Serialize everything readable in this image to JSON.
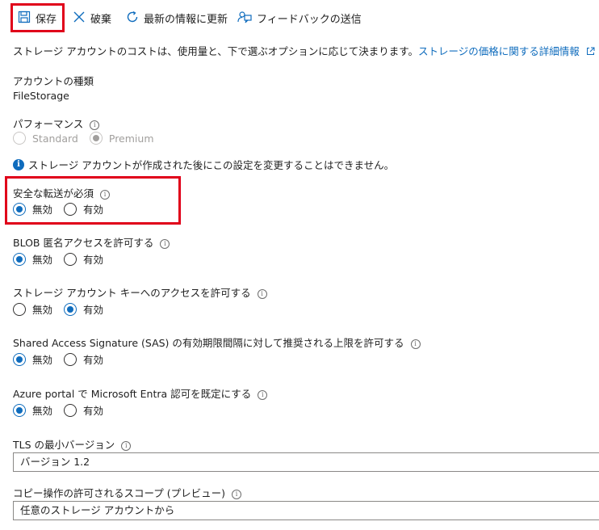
{
  "toolbar": {
    "save_label": "保存",
    "discard_label": "破棄",
    "refresh_label": "最新の情報に更新",
    "feedback_label": "フィードバックの送信"
  },
  "description": {
    "text": "ストレージ アカウントのコストは、使用量と、下で選ぶオプションに応じて決まります。",
    "link_text": "ストレージの価格に関する詳細情報"
  },
  "account_kind": {
    "label": "アカウントの種類",
    "value": "FileStorage"
  },
  "performance": {
    "label": "パフォーマンス",
    "options": [
      "Standard",
      "Premium"
    ],
    "selected": "Premium"
  },
  "notice": "ストレージ アカウントが作成された後にこの設定を変更することはできません。",
  "settings": {
    "secure_transfer": {
      "label": "安全な転送が必須",
      "options": [
        "無効",
        "有効"
      ],
      "selected": "無効"
    },
    "blob_anonymous": {
      "label": "BLOB 匿名アクセスを許可する",
      "options": [
        "無効",
        "有効"
      ],
      "selected": "無効"
    },
    "account_key": {
      "label": "ストレージ アカウント キーへのアクセスを許可する",
      "options": [
        "無効",
        "有効"
      ],
      "selected": "有効"
    },
    "sas_expiry": {
      "label": "Shared Access Signature (SAS) の有効期限間隔に対して推奨される上限を許可する",
      "options": [
        "無効",
        "有効"
      ],
      "selected": "無効"
    },
    "entra_default": {
      "label": "Azure portal で Microsoft Entra 認可を既定にする",
      "options": [
        "無効",
        "有効"
      ],
      "selected": "無効"
    }
  },
  "tls": {
    "label": "TLS の最小バージョン",
    "value": "バージョン 1.2"
  },
  "copy_scope": {
    "label": "コピー操作の許可されるスコープ (プレビュー)",
    "value": "任意のストレージ アカウントから"
  },
  "colors": {
    "accent": "#0f6cbd",
    "highlight": "#e0001a"
  }
}
